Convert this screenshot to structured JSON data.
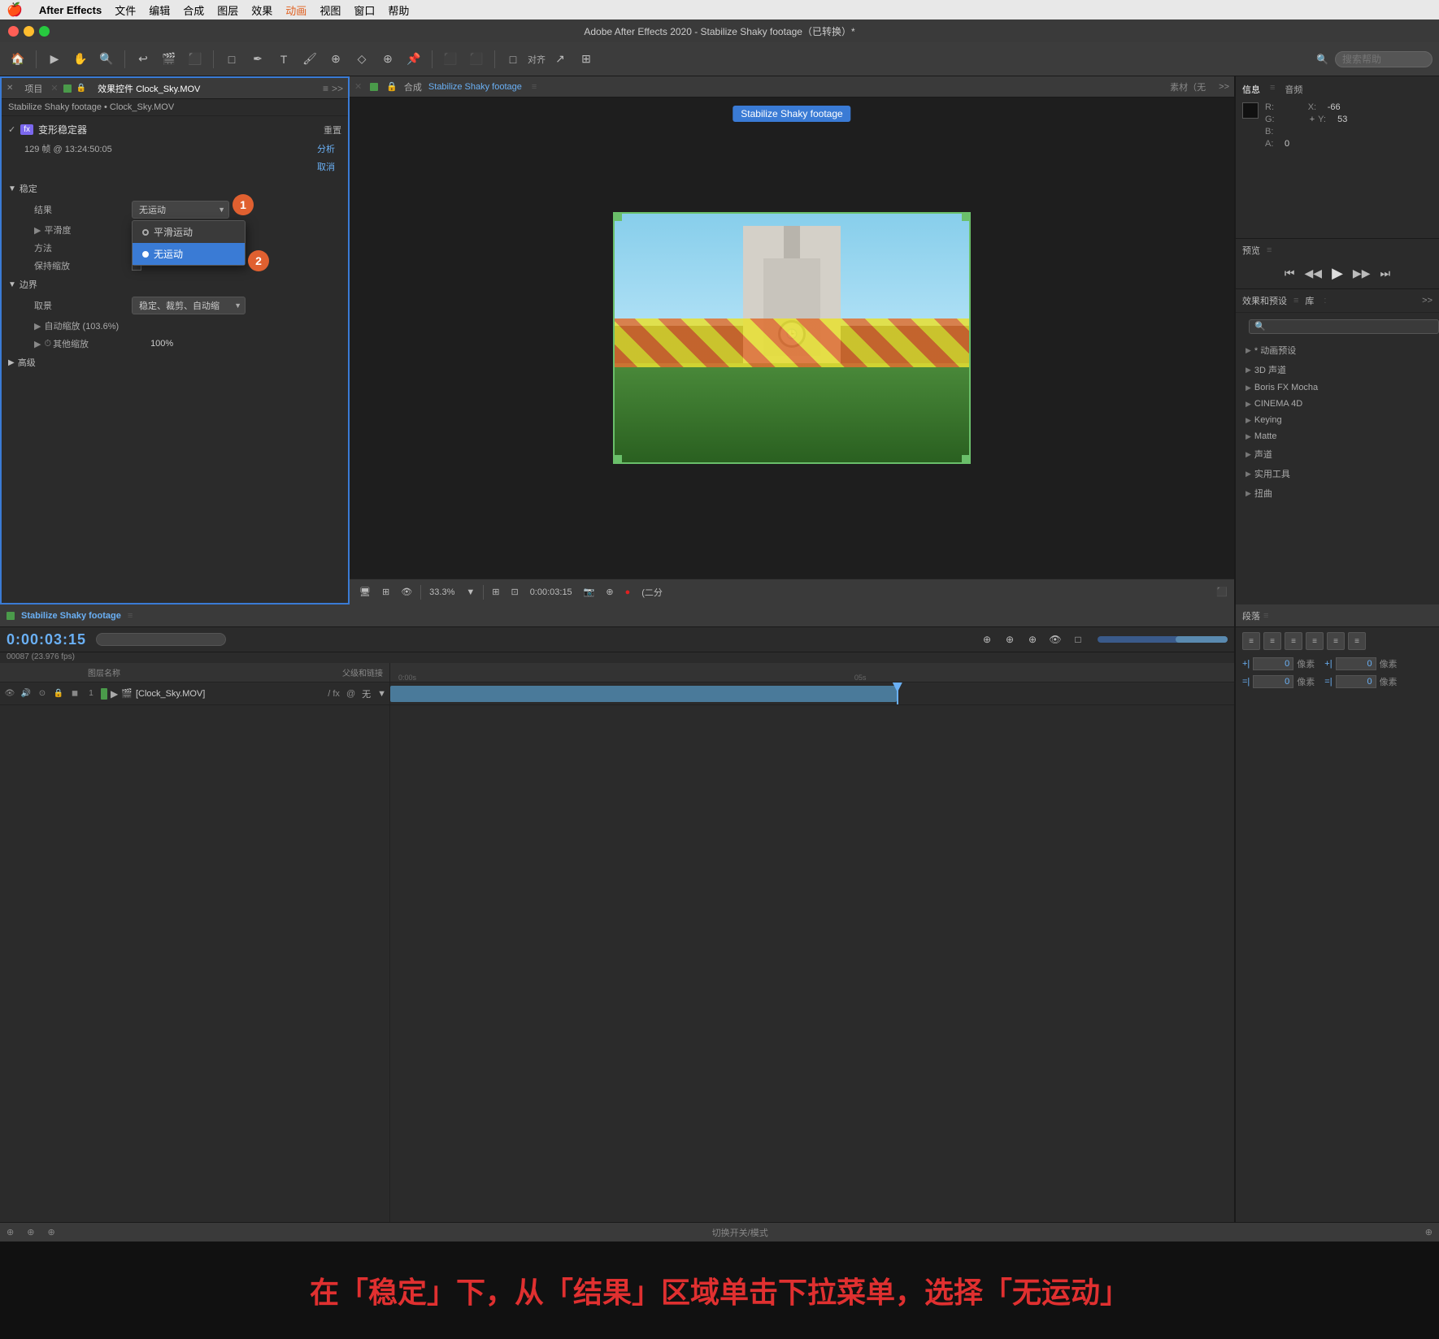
{
  "app": {
    "title": "Adobe After Effects 2020 - Stabilize Shaky footage（已转换）*",
    "menu": {
      "apple": "🍎",
      "items": [
        "After Effects",
        "文件",
        "编辑",
        "合成",
        "图层",
        "效果",
        "动画",
        "视图",
        "窗口",
        "帮助"
      ]
    }
  },
  "titlebar_buttons": {
    "close": "close",
    "minimize": "minimize",
    "maximize": "maximize"
  },
  "toolbar": {
    "search_placeholder": "搜索帮助",
    "align_label": "对齐"
  },
  "left_panel": {
    "tabs": [
      "项目",
      "效果控件 Clock_Sky.MOV"
    ],
    "breadcrumb": "Stabilize Shaky footage • Clock_Sky.MOV",
    "fx": {
      "badge": "fx",
      "name": "变形稳定器",
      "reset_label": "重置",
      "frames": "129 帧 @ 13:24:50:05",
      "analyze_label": "分析",
      "cancel_label": "取消",
      "sections": {
        "stabilize": {
          "label": "稳定",
          "result_label": "结果",
          "result_value": "无运动",
          "smoothness_label": "平滑度",
          "method_label": "方法",
          "preserve_scale_label": "保持缩放"
        },
        "borders": {
          "label": "边界",
          "framing_label": "取景",
          "framing_value": "稳定、裁剪、自动缩",
          "auto_scale_label": "自动缩放 (103.6%)",
          "other_scale_label": "其他缩放",
          "other_scale_value": "100%"
        },
        "advanced": {
          "label": "高级"
        }
      }
    }
  },
  "dropdown": {
    "options": [
      "平滑运动",
      "无运动"
    ],
    "selected": "无运动",
    "trigger_value": "无运动"
  },
  "step_badges": [
    "1",
    "2"
  ],
  "composition": {
    "panel_label": "合成",
    "name": "Stabilize Shaky footage",
    "viewer_label": "Stabilize Shaky footage",
    "tabs": [
      "素材（无",
      ""
    ],
    "timecode": "0:00:03:15",
    "zoom": "33.3%",
    "resolution": "(二分"
  },
  "info_panel": {
    "tabs": [
      "信息",
      "音频"
    ],
    "labels": {
      "r": "R:",
      "g": "G:",
      "b": "B:",
      "a": "A:",
      "x": "X:",
      "y": "Y:"
    },
    "values": {
      "r": "",
      "g": "",
      "b": "",
      "a": "0",
      "x": "-66",
      "y": "53"
    }
  },
  "preview_panel": {
    "label": "预览",
    "controls": [
      "⏮",
      "◀◀",
      "▶",
      "▶▶",
      "⏭"
    ]
  },
  "effects_panel": {
    "header_tabs": [
      "效果和预设",
      "库"
    ],
    "search_placeholder": "🔍",
    "items": [
      "* 动画预设",
      "3D 声道",
      "Boris FX Mocha",
      "CINEMA 4D",
      "Keying",
      "Matte",
      "声道",
      "实用工具",
      "扭曲"
    ]
  },
  "timeline": {
    "comp_name": "Stabilize Shaky footage",
    "timecode": "0:00:03:15",
    "fps": "00087 (23.976 fps)",
    "col_headers": [
      "图层名称",
      "父级和链接"
    ],
    "layers": [
      {
        "num": "1",
        "name": "[Clock_Sky.MOV]",
        "parent": "无"
      }
    ],
    "ruler": {
      "marks": [
        "0:00s",
        "05s"
      ]
    }
  },
  "duan_panel": {
    "label": "段落",
    "pixel_labels": [
      "像素",
      "像素",
      "像素",
      "像素"
    ],
    "pixel_values": [
      "0",
      "0",
      "0",
      "0"
    ],
    "arrow_labels": [
      "+|",
      "=|",
      "+|",
      "=|"
    ]
  },
  "status_bar": {
    "center_label": "切换开关/模式"
  },
  "caption": {
    "text": "在「稳定」下，从「结果」区域单击下拉菜单，选择「无运动」"
  }
}
